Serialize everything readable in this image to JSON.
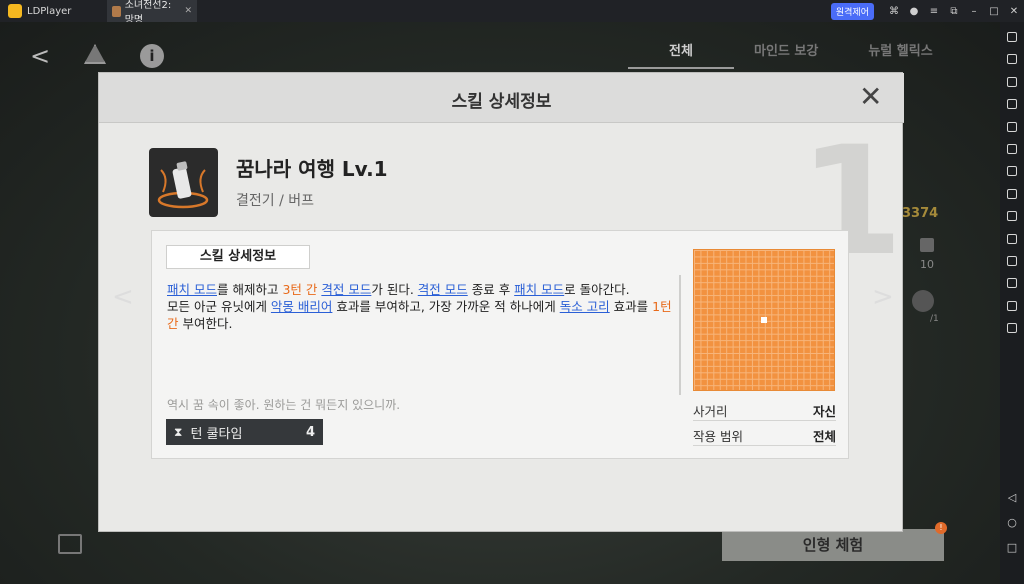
{
  "window": {
    "app_name": "LDPlayer",
    "tab_label": "소녀전선2: 망명",
    "remote_label": "원격제어"
  },
  "game": {
    "tabs": [
      "전체",
      "마인드 보강",
      "뉴럴 헬릭스"
    ],
    "side_number": "3374",
    "side_count": "10",
    "side_fraction": "/1",
    "experience_button": "인형 체험",
    "badge": "!"
  },
  "dialog": {
    "title": "스킬 상세정보",
    "big_number": "1",
    "skill_name": "꿈나라 여행 Lv.1",
    "skill_type": "결전기 / 버프",
    "panel_tab": "스킬 상세정보",
    "description": {
      "line1": [
        {
          "t": "패치 모드",
          "s": "lk"
        },
        {
          "t": "를 해제하고 ",
          "s": ""
        },
        {
          "t": "3턴 간",
          "s": "or"
        },
        {
          "t": " ",
          "s": ""
        },
        {
          "t": "격전 모드",
          "s": "lk"
        },
        {
          "t": "가 된다. ",
          "s": ""
        },
        {
          "t": "격전 모드",
          "s": "lk"
        },
        {
          "t": " 종료 후 ",
          "s": ""
        },
        {
          "t": "패치 모드",
          "s": "lk"
        },
        {
          "t": "로 돌아간다.",
          "s": ""
        }
      ],
      "line2": [
        {
          "t": "모든 아군 유닛에게 ",
          "s": ""
        },
        {
          "t": "악몽 배리어",
          "s": "lk"
        },
        {
          "t": " 효과를 부여하고, 가장 가까운 적 하나에게 ",
          "s": ""
        },
        {
          "t": "독소 고리",
          "s": "lk"
        },
        {
          "t": " 효과를 ",
          "s": ""
        },
        {
          "t": "1턴 간",
          "s": "or"
        },
        {
          "t": " 부여한다.",
          "s": ""
        }
      ]
    },
    "flavor_text": "역시 꿈 속이 좋아. 원하는 건 뭐든지 있으니까.",
    "cooldown_label": "턴 쿨타임",
    "cooldown_value": "4",
    "range_label": "사거리",
    "range_value": "자신",
    "scope_label": "작용 범위",
    "scope_value": "전체"
  },
  "colors": {
    "link": "#2a5fd6",
    "highlight": "#e86a1a",
    "grid": "#f29240"
  }
}
